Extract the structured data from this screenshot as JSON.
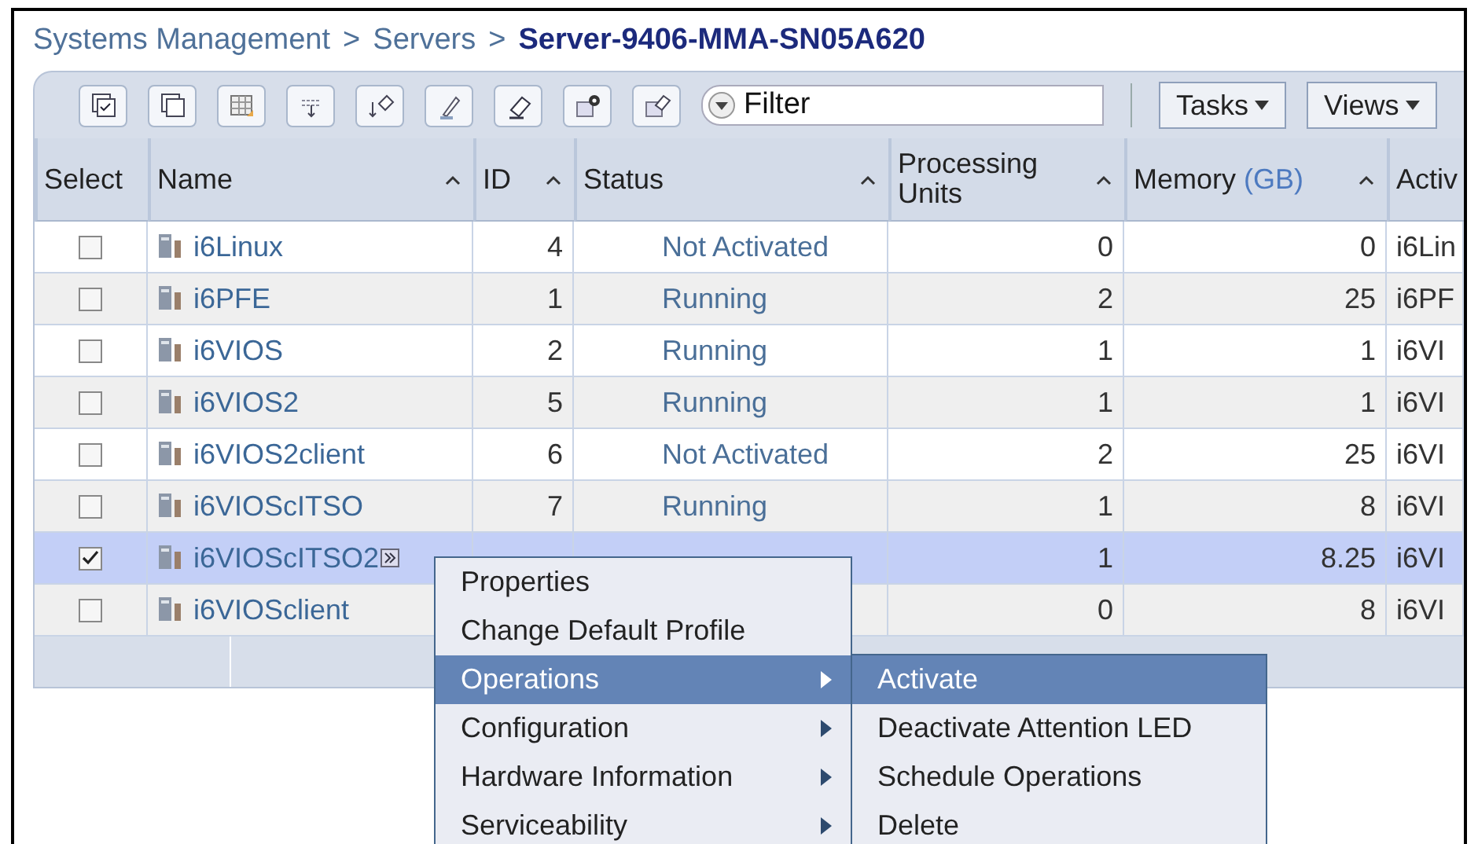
{
  "breadcrumb": [
    {
      "label": "Systems Management",
      "kind": "link"
    },
    {
      "label": ">",
      "kind": "separator"
    },
    {
      "label": "Servers",
      "kind": "link"
    },
    {
      "label": ">",
      "kind": "separator"
    },
    {
      "label": "Server-9406-MMA-SN05A620",
      "kind": "current"
    }
  ],
  "toolbar": {
    "filter": {
      "placeholder": "Filter"
    },
    "buttons": [
      "Tasks",
      "Views"
    ]
  },
  "table": {
    "columns": [
      {
        "label": "Select",
        "sortable": false
      },
      {
        "label": "Name",
        "sortable": true
      },
      {
        "label": "ID",
        "sortable": true
      },
      {
        "label": "Status",
        "sortable": true
      },
      {
        "label": "Processing Units",
        "sortable": true
      },
      {
        "label": "Memory",
        "unit": "(GB)",
        "sortable": true
      },
      {
        "label": "Activ",
        "sortable": false
      }
    ],
    "rows": [
      {
        "selected": false,
        "name": "i6Linux",
        "menu_button": false,
        "id": "4",
        "status": "Not Activated",
        "units": "0",
        "memory": "0",
        "active": "i6Lin"
      },
      {
        "selected": false,
        "name": "i6PFE",
        "menu_button": false,
        "id": "1",
        "status": "Running",
        "units": "2",
        "memory": "25",
        "active": "i6PF"
      },
      {
        "selected": false,
        "name": "i6VIOS",
        "menu_button": false,
        "id": "2",
        "status": "Running",
        "units": "1",
        "memory": "1",
        "active": "i6VI"
      },
      {
        "selected": false,
        "name": "i6VIOS2",
        "menu_button": false,
        "id": "5",
        "status": "Running",
        "units": "1",
        "memory": "1",
        "active": "i6VI"
      },
      {
        "selected": false,
        "name": "i6VIOS2client",
        "menu_button": false,
        "id": "6",
        "status": "Not Activated",
        "units": "2",
        "memory": "25",
        "active": "i6VI"
      },
      {
        "selected": false,
        "name": "i6VIOScITSO",
        "menu_button": false,
        "id": "7",
        "status": "Running",
        "units": "1",
        "memory": "8",
        "active": "i6VI"
      },
      {
        "selected": true,
        "name": "i6VIOScITSO2",
        "menu_button": true,
        "units": "1",
        "memory": "8.25",
        "active": "i6VI"
      },
      {
        "selected": false,
        "name": "i6VIOSclient",
        "menu_button": false,
        "units": "0",
        "memory": "8",
        "active": "i6VI"
      }
    ]
  },
  "context_menu": {
    "items": [
      {
        "label": "Properties",
        "submenu": false,
        "selected": false
      },
      {
        "label": "Change Default Profile",
        "submenu": false,
        "selected": false
      },
      {
        "label": "Operations",
        "submenu": true,
        "selected": true
      },
      {
        "label": "Configuration",
        "submenu": true,
        "selected": false
      },
      {
        "label": "Hardware Information",
        "submenu": true,
        "selected": false
      },
      {
        "label": "Serviceability",
        "submenu": true,
        "selected": false
      }
    ]
  },
  "submenu": {
    "items": [
      {
        "label": "Activate",
        "selected": true
      },
      {
        "label": "Deactivate Attention LED",
        "selected": false
      },
      {
        "label": "Schedule Operations",
        "selected": false
      },
      {
        "label": "Delete",
        "selected": false
      }
    ]
  }
}
